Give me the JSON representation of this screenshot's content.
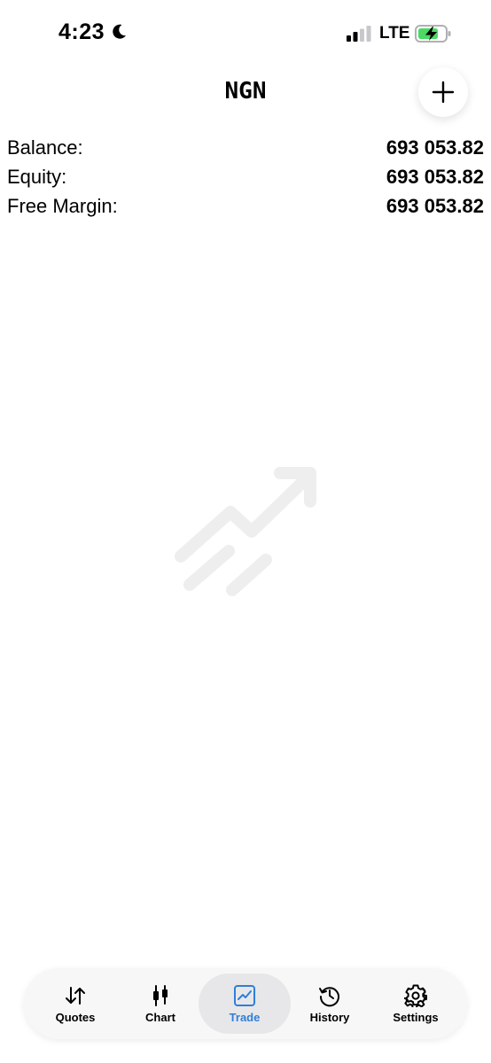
{
  "status_bar": {
    "time": "4:23",
    "network": "LTE",
    "icons": [
      "moon-icon",
      "signal-icon",
      "battery-charging-icon"
    ]
  },
  "header": {
    "title": "NGN",
    "add_icon": "plus-icon"
  },
  "account": [
    {
      "label": "Balance:",
      "value": "693 053.82"
    },
    {
      "label": "Equity:",
      "value": "693 053.82"
    },
    {
      "label": "Free Margin:",
      "value": "693 053.82"
    }
  ],
  "empty_state": {
    "icon": "trending-up-arrow-icon",
    "color": "#eeeeee"
  },
  "tabs": [
    {
      "label": "Quotes",
      "icon": "sort-arrows-icon",
      "active": false
    },
    {
      "label": "Chart",
      "icon": "candlestick-icon",
      "active": false
    },
    {
      "label": "Trade",
      "icon": "trade-chart-icon",
      "active": true
    },
    {
      "label": "History",
      "icon": "history-clock-icon",
      "active": false
    },
    {
      "label": "Settings",
      "icon": "gear-icon",
      "active": false
    }
  ],
  "colors": {
    "accent": "#2f7fd8",
    "battery_green": "#4cd964",
    "tab_bar_bg": "#f7f7f7",
    "active_tab_bg": "#e7e7e9"
  }
}
